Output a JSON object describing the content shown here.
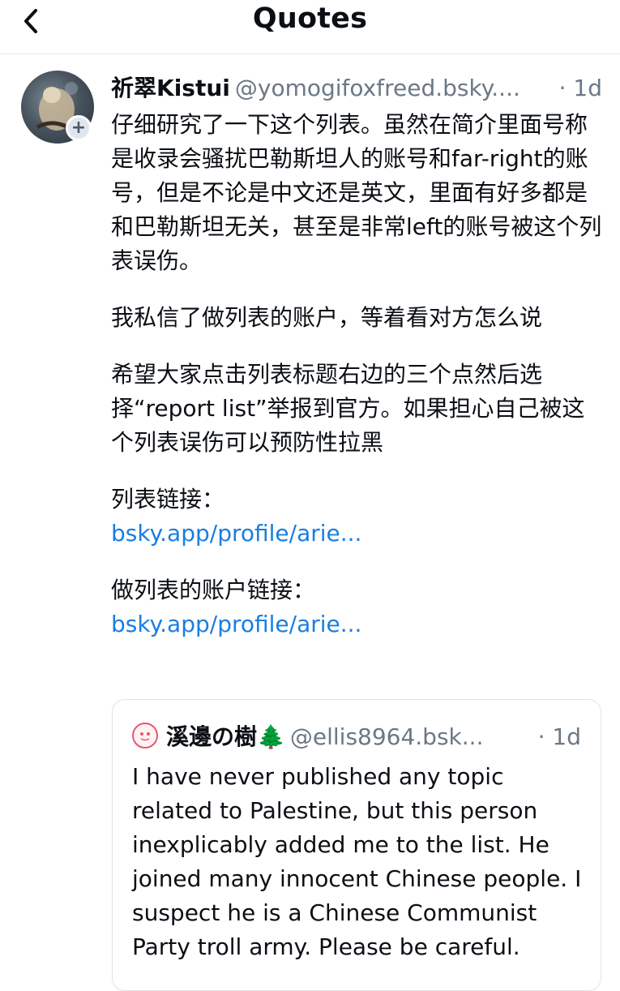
{
  "header": {
    "title": "Quotes",
    "back_icon": "chevron-left-icon"
  },
  "post": {
    "author_name": "祈翠Kistui",
    "author_handle": "@yomogifoxfreed.bsky....",
    "time": "· 1d",
    "follow_icon": "plus-icon",
    "paragraphs": [
      "仔细研究了一下这个列表。虽然在简介里面号称是收录会骚扰巴勒斯坦人的账号和far-right的账号，但是不论是中文还是英文，里面有好多都是和巴勒斯坦无关，甚至是非常left的账号被这个列表误伤。",
      "我私信了做列表的账户，等着看对方怎么说",
      "希望大家点击列表标题右边的三个点然后选择“report list”举报到官方。如果担心自己被这个列表误伤可以预防性拉黑"
    ],
    "list_link_label": "列表链接：",
    "list_link": "bsky.app/profile/arie...",
    "account_link_label": "做列表的账户链接：",
    "account_link": "bsky.app/profile/arie..."
  },
  "quote": {
    "author_name": "溪邊の樹🌲",
    "author_handle": "@ellis8964.bsk...",
    "time": "· 1d",
    "body": "I have never published any topic related to Palestine, but this person inexplicably added me to the list. He joined many innocent Chinese people. I suspect he is a Chinese Communist Party troll army. Please be careful."
  },
  "colors": {
    "link": "#1a7ee0",
    "muted": "#6b7886",
    "text": "#0b0f14"
  }
}
